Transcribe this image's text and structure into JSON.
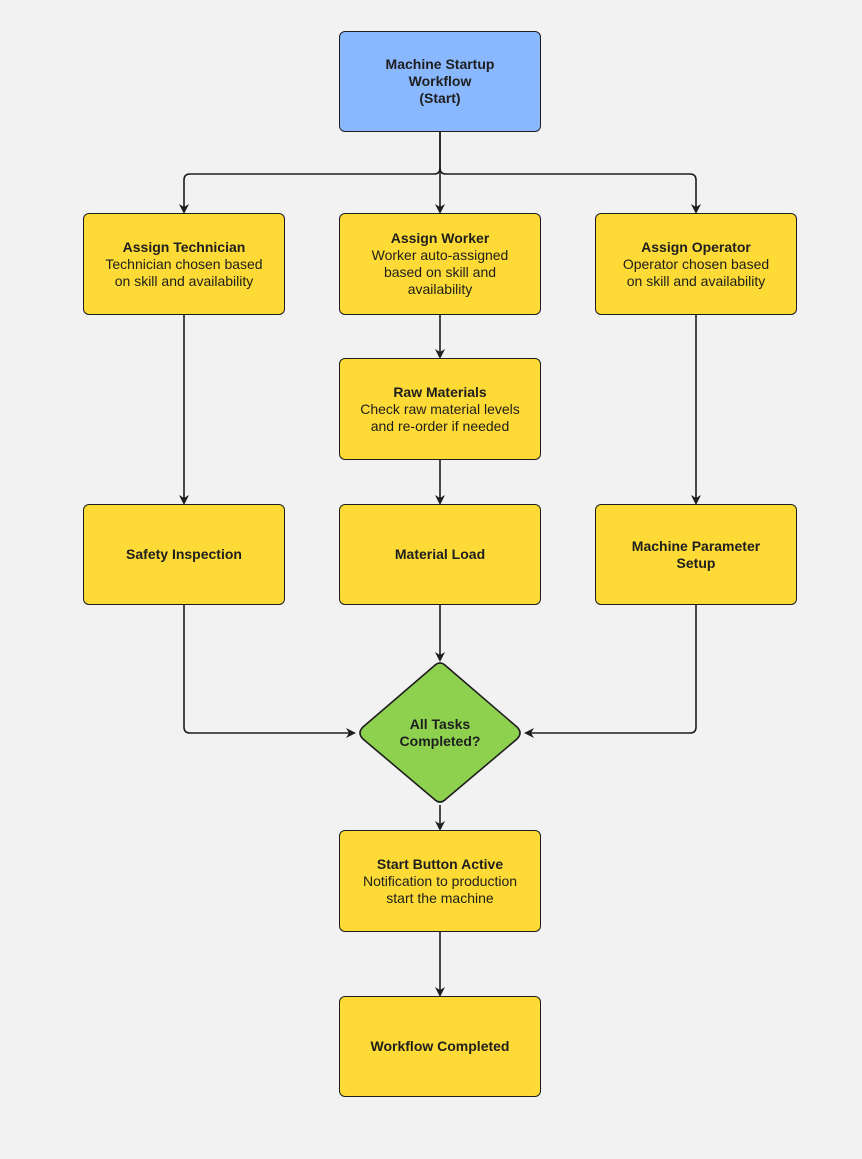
{
  "diagram": {
    "title": "Machine Startup Workflow",
    "colors": {
      "background": "#f2f2f2",
      "start": "#8ab8ff",
      "process": "#fdda35",
      "decision": "#8ed14f",
      "stroke": "#1e1e1e"
    },
    "nodes": {
      "start": {
        "title_lines": [
          "Machine Startup",
          "Workflow",
          "(Start)"
        ]
      },
      "assign_technician": {
        "title": "Assign Technician",
        "desc_lines": [
          "Technician chosen based",
          "on skill and availability"
        ]
      },
      "assign_worker": {
        "title": "Assign Worker",
        "desc_lines": [
          "Worker auto-assigned",
          "based on skill and",
          "availability"
        ]
      },
      "assign_operator": {
        "title": "Assign Operator",
        "desc_lines": [
          "Operator chosen based",
          "on skill and availability"
        ]
      },
      "raw_materials": {
        "title": "Raw Materials",
        "desc_lines": [
          "Check raw material levels",
          "and re-order if needed"
        ]
      },
      "safety_inspection": {
        "title": "Safety Inspection"
      },
      "material_load": {
        "title": "Material Load"
      },
      "machine_parameter_setup": {
        "title_lines": [
          "Machine Parameter",
          "Setup"
        ]
      },
      "all_tasks_completed": {
        "title_lines": [
          "All Tasks",
          "Completed?"
        ]
      },
      "start_button_active": {
        "title": "Start Button Active",
        "desc_lines": [
          "Notification to production",
          "start the machine"
        ]
      },
      "workflow_completed": {
        "title": "Workflow Completed"
      }
    },
    "edges": [
      {
        "from": "start",
        "to": "assign_technician"
      },
      {
        "from": "start",
        "to": "assign_worker"
      },
      {
        "from": "start",
        "to": "assign_operator"
      },
      {
        "from": "assign_technician",
        "to": "safety_inspection"
      },
      {
        "from": "assign_worker",
        "to": "raw_materials"
      },
      {
        "from": "raw_materials",
        "to": "material_load"
      },
      {
        "from": "assign_operator",
        "to": "machine_parameter_setup"
      },
      {
        "from": "safety_inspection",
        "to": "all_tasks_completed"
      },
      {
        "from": "material_load",
        "to": "all_tasks_completed"
      },
      {
        "from": "machine_parameter_setup",
        "to": "all_tasks_completed"
      },
      {
        "from": "all_tasks_completed",
        "to": "start_button_active"
      },
      {
        "from": "start_button_active",
        "to": "workflow_completed"
      }
    ]
  }
}
